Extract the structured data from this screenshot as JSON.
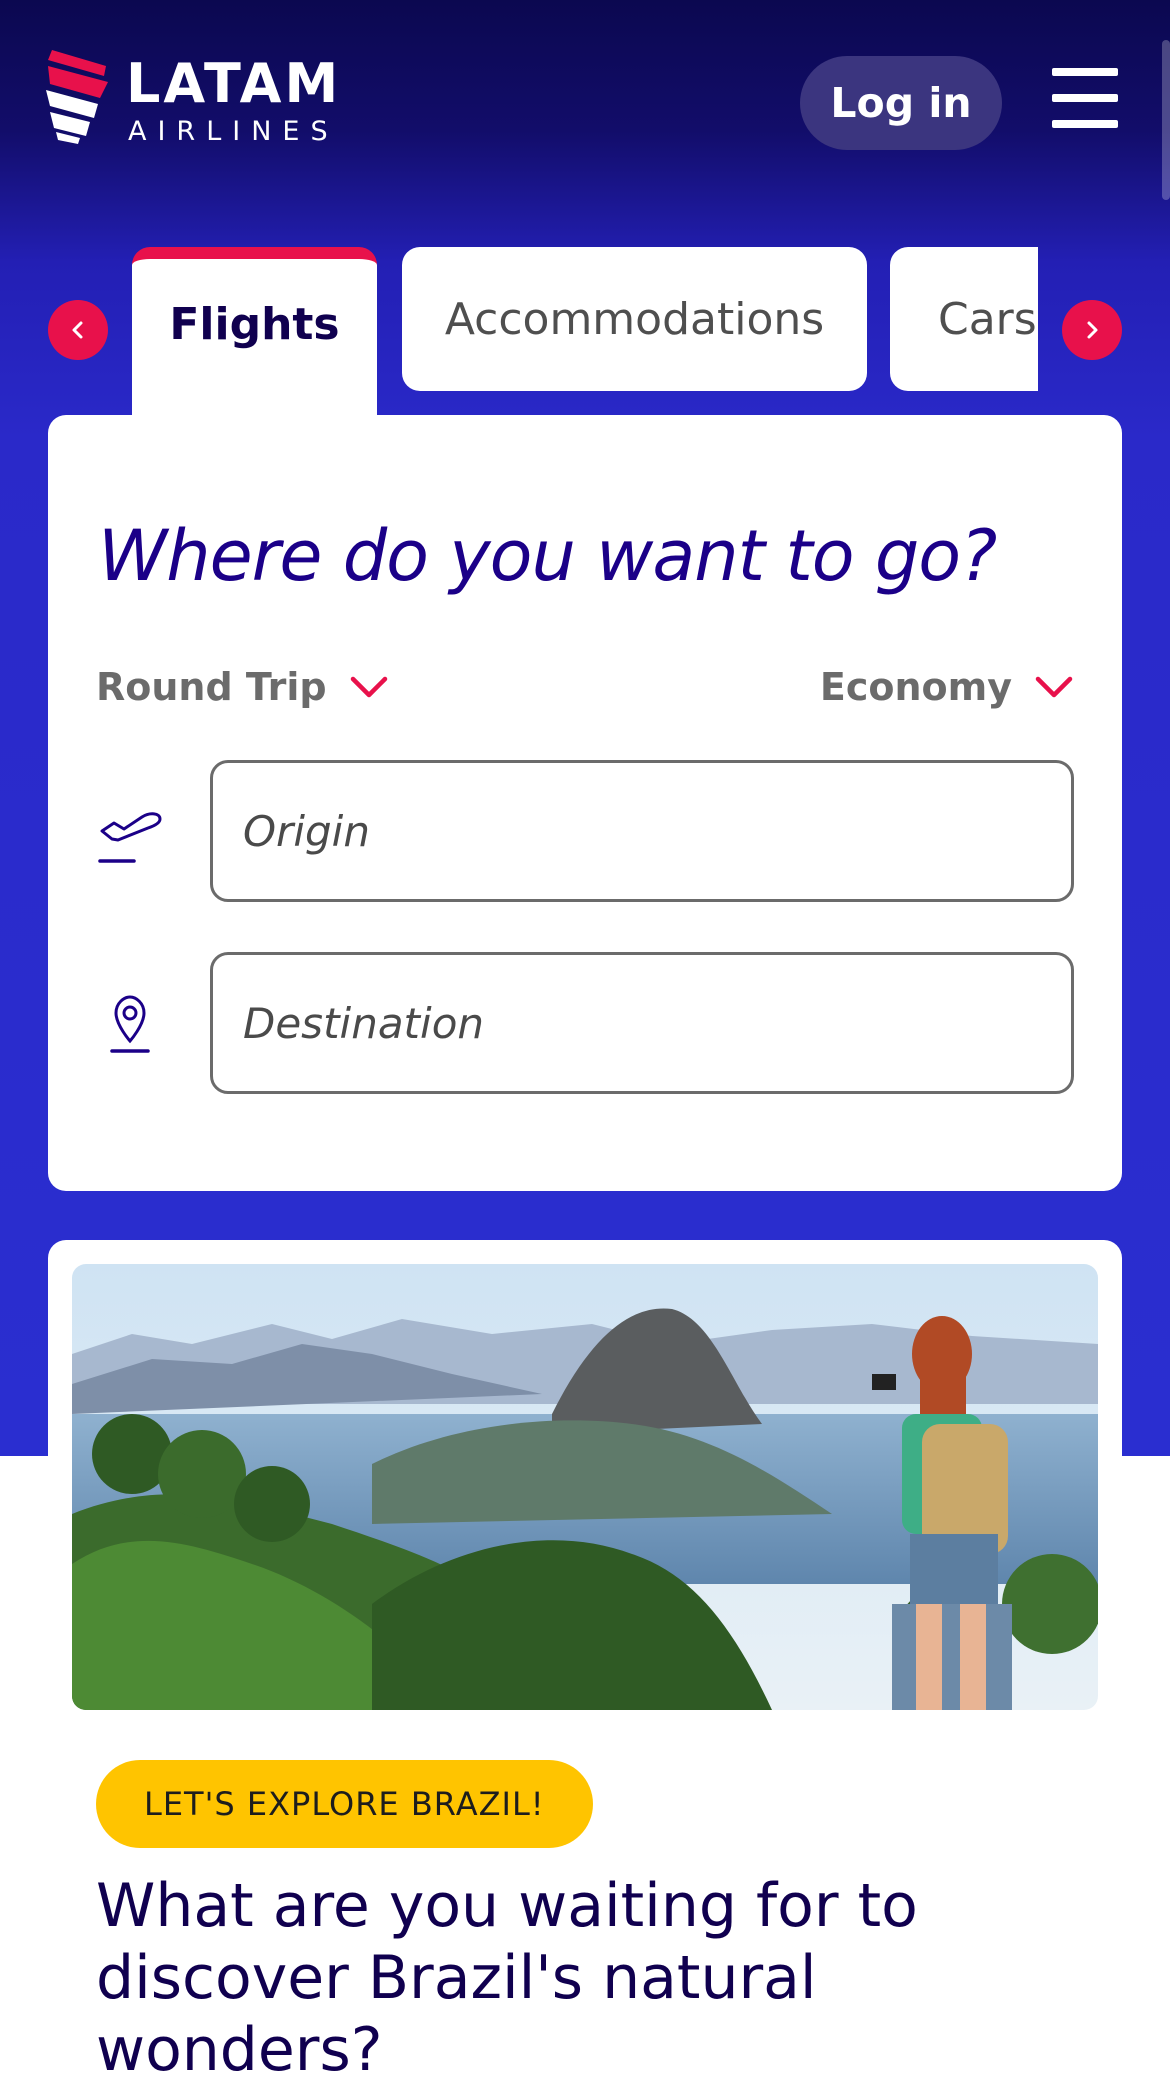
{
  "header": {
    "logo_name": "LATAM",
    "logo_sub": "AIRLINES",
    "login_label": "Log in",
    "menu_icon": "hamburger-menu-icon"
  },
  "tabs": [
    {
      "label": "Flights",
      "active": true
    },
    {
      "label": "Accommodations",
      "active": false
    },
    {
      "label": "Cars",
      "active": false
    }
  ],
  "search": {
    "title": "Where do you want to go?",
    "trip_type": "Round Trip",
    "cabin_class": "Economy",
    "origin_placeholder": "Origin",
    "destination_placeholder": "Destination"
  },
  "promo": {
    "badge": "LET'S EXPLORE BRAZIL!",
    "heading": "What are you waiting for to discover Brazil's natural wonders?"
  },
  "colors": {
    "brand_navy": "#10004f",
    "brand_blue": "#2a29c9",
    "accent_red": "#e8114b",
    "badge_yellow": "#ffc400"
  }
}
